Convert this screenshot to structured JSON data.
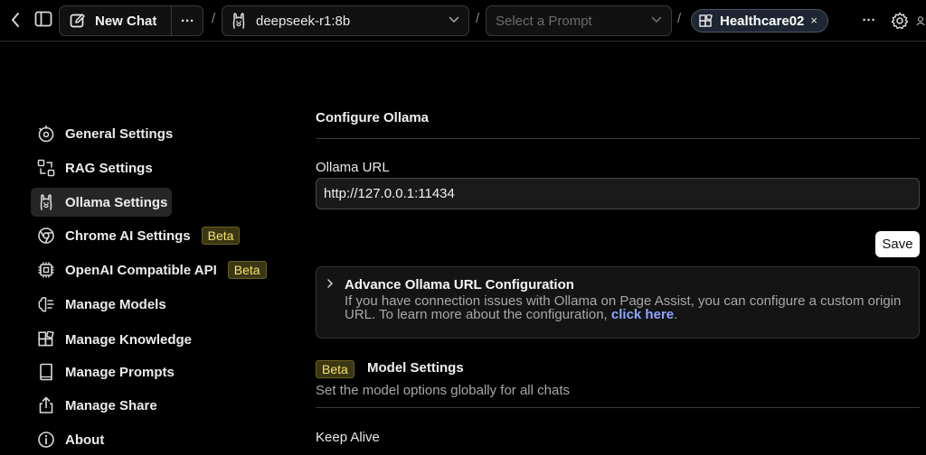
{
  "topbar": {
    "new_chat_label": "New Chat",
    "model_label": "deepseek-r1:8b",
    "prompt_placeholder": "Select a Prompt",
    "knowledge_label": "Healthcare02",
    "knowledge_close": "×",
    "more_label": "···",
    "separator": "/"
  },
  "sidebar": {
    "items": [
      {
        "label": "General Settings",
        "icon": "general-settings-icon"
      },
      {
        "label": "RAG Settings",
        "icon": "rag-icon"
      },
      {
        "label": "Ollama Settings",
        "icon": "ollama-icon",
        "active": true
      },
      {
        "label": "Chrome AI Settings",
        "icon": "chrome-icon",
        "badge": "Beta"
      },
      {
        "label": "OpenAI Compatible API",
        "icon": "chip-icon",
        "badge": "Beta"
      },
      {
        "label": "Manage Models",
        "icon": "brain-icon"
      },
      {
        "label": "Manage Knowledge",
        "icon": "blocks-icon"
      },
      {
        "label": "Manage Prompts",
        "icon": "book-icon"
      },
      {
        "label": "Manage Share",
        "icon": "share-icon"
      },
      {
        "label": "About",
        "icon": "info-icon"
      }
    ]
  },
  "main": {
    "configure_heading": "Configure Ollama",
    "url_label": "Ollama URL",
    "url_value": "http://127.0.0.1:11434",
    "save_label": "Save",
    "advanced": {
      "title": "Advance Ollama URL Configuration",
      "description": "If you have connection issues with Ollama on Page Assist, you can configure a custom origin URL. To learn more about the configuration, ",
      "link_text": "click here",
      "trailing": "."
    },
    "model_settings": {
      "badge": "Beta",
      "heading": "Model Settings",
      "subtitle": "Set the model options globally for all chats"
    },
    "keep_alive_label": "Keep Alive"
  },
  "colors": {
    "background": "#000000",
    "beta_text": "#f4e36a",
    "link": "#8ea6ff",
    "knowledge_pill": "#1e2633"
  }
}
